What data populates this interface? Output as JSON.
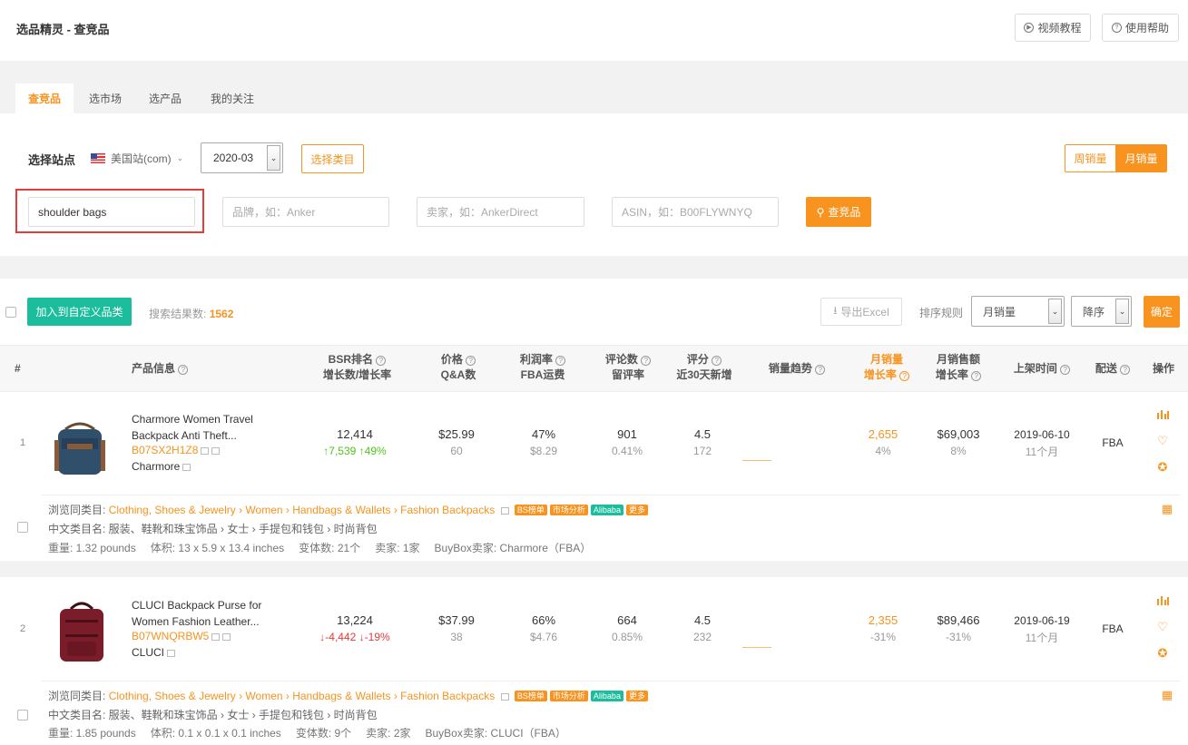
{
  "app": {
    "title": "选品精灵 - 查竞品",
    "video_tutorial": "视频教程",
    "help": "使用帮助"
  },
  "tabs": [
    {
      "label": "查竞品",
      "active": true
    },
    {
      "label": "选市场",
      "active": false
    },
    {
      "label": "选产品",
      "active": false
    },
    {
      "label": "我的关注",
      "active": false
    }
  ],
  "filters": {
    "site_label": "选择站点",
    "site_value": "美国站(com)",
    "month_value": "2020-03",
    "select_category": "选择类目",
    "weekly_sales": "周销量",
    "monthly_sales": "月销量",
    "keyword_value": "shoulder bags",
    "brand_placeholder": "品牌，如：Anker",
    "seller_placeholder": "卖家，如：AnkerDirect",
    "asin_placeholder": "ASIN，如：B00FLYWNYQ",
    "search_button": "查竞品"
  },
  "toolbar": {
    "add_custom": "加入到自定义品类",
    "result_label": "搜索结果数:",
    "result_count": "1562",
    "export": "导出Excel",
    "sort_label": "排序规则",
    "sort_field": "月销量",
    "sort_order": "降序",
    "confirm": "确定"
  },
  "table": {
    "headers": {
      "index": "#",
      "product": "产品信息",
      "bsr_1": "BSR排名",
      "bsr_2": "增长数/增长率",
      "price_1": "价格",
      "price_2": "Q&A数",
      "profit_1": "利润率",
      "profit_2": "FBA运费",
      "reviews_1": "评论数",
      "reviews_2": "留评率",
      "rating_1": "评分",
      "rating_2": "近30天新增",
      "trend": "销量趋势",
      "msales_1": "月销量",
      "msales_2": "增长率",
      "mrev_1": "月销售额",
      "mrev_2": "增长率",
      "listed": "上架时间",
      "fulfill": "配送",
      "ops": "操作"
    },
    "rows": [
      {
        "index": "1",
        "title_1": "Charmore Women Travel",
        "title_2": "Backpack Anti Theft...",
        "asin": "B07SX2H1Z8",
        "brand": "Charmore",
        "bsr": "12,414",
        "bsr_change": "↑7,539",
        "bsr_rate": "↑49%",
        "price": "$25.99",
        "qa": "60",
        "profit": "47%",
        "fba_fee": "$8.29",
        "reviews": "901",
        "review_rate": "0.41%",
        "rating": "4.5",
        "new_ratings": "172",
        "monthly_sales": "2,655",
        "monthly_sales_growth": "4%",
        "monthly_revenue": "$69,003",
        "monthly_revenue_growth": "8%",
        "listed_date": "2019-06-10",
        "listed_age": "11个月",
        "fulfillment": "FBA",
        "category_label": "浏览同类目:",
        "category_path": "Clothing, Shoes & Jewelry › Women › Handbags & Wallets › Fashion Backpacks",
        "tags": [
          "BS榜单",
          "市场分析",
          "Alibaba",
          "更多"
        ],
        "cn_category": "中文类目名: 服装、鞋靴和珠宝饰品 › 女士 › 手提包和钱包 › 时尚背包",
        "weight": "重量: 1.32 pounds",
        "volume": "体积: 13 x 5.9 x 13.4 inches",
        "variants": "变体数: 21个",
        "sellers": "卖家: 1家",
        "buybox": "BuyBox卖家: Charmore（FBA）"
      },
      {
        "index": "2",
        "title_1": "CLUCI Backpack Purse for",
        "title_2": "Women Fashion Leather...",
        "asin": "B07WNQRBW5",
        "brand": "CLUCI",
        "bsr": "13,224",
        "bsr_change": "↓-4,442",
        "bsr_rate": "↓-19%",
        "price": "$37.99",
        "qa": "38",
        "profit": "66%",
        "fba_fee": "$4.76",
        "reviews": "664",
        "review_rate": "0.85%",
        "rating": "4.5",
        "new_ratings": "232",
        "monthly_sales": "2,355",
        "monthly_sales_growth": "-31%",
        "monthly_revenue": "$89,466",
        "monthly_revenue_growth": "-31%",
        "listed_date": "2019-06-19",
        "listed_age": "11个月",
        "fulfillment": "FBA",
        "category_label": "浏览同类目:",
        "category_path": "Clothing, Shoes & Jewelry › Women › Handbags & Wallets › Fashion Backpacks",
        "tags": [
          "BS榜单",
          "市场分析",
          "Alibaba",
          "更多"
        ],
        "cn_category": "中文类目名: 服装、鞋靴和珠宝饰品 › 女士 › 手提包和钱包 › 时尚背包",
        "weight": "重量: 1.85 pounds",
        "volume": "体积: 0.1 x 0.1 x 0.1 inches",
        "variants": "变体数: 9个",
        "sellers": "卖家: 2家",
        "buybox": "BuyBox卖家: CLUCI（FBA）"
      }
    ]
  },
  "colors": {
    "accent": "#f7931e",
    "green": "#1bbd9c",
    "up": "#52c41a",
    "down": "#e4393c",
    "highlight": "#e43b3b"
  }
}
